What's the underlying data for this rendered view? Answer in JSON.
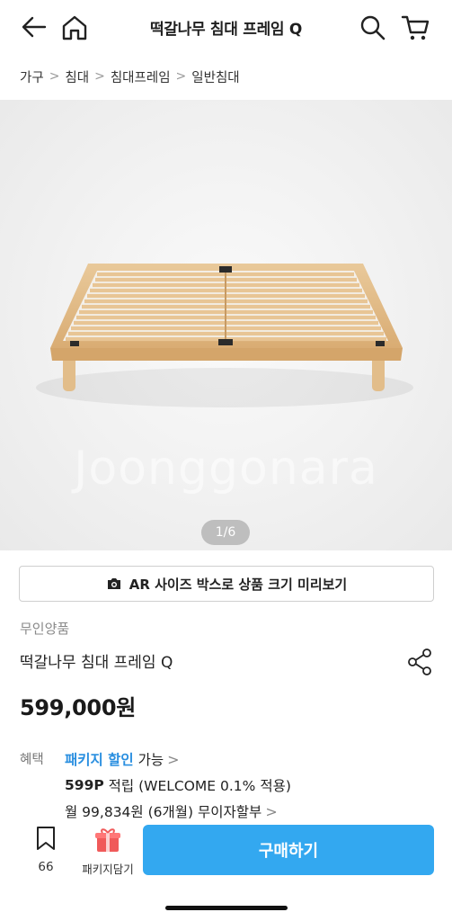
{
  "header": {
    "title": "떡갈나무 침대 프레임 Q",
    "back_icon": "back-arrow-icon",
    "home_icon": "home-icon",
    "search_icon": "search-icon",
    "cart_icon": "cart-icon"
  },
  "breadcrumb": [
    "가구",
    "침대",
    "침대프레임",
    "일반침대"
  ],
  "gallery": {
    "counter": "1/6",
    "watermark": "Joonggonara"
  },
  "ar_button": {
    "icon": "camera-icon",
    "label": "AR 사이즈 박스로 상품 크기 미리보기"
  },
  "product": {
    "brand": "무인양품",
    "name": "떡갈나무 침대 프레임 Q",
    "share_icon": "share-icon",
    "price": "599,000원"
  },
  "benefits": {
    "label": "혜택",
    "package_highlight": "패키지 할인",
    "package_suffix": "가능",
    "points_strong": "599P",
    "points_text": "적립 (WELCOME 0.1% 적용)",
    "installment": "월 99,834원 (6개월) 무이자할부"
  },
  "bottom_bar": {
    "bookmark_count": "66",
    "package_label": "패키지담기",
    "buy_label": "구매하기",
    "buy_color": "#33a8f0"
  }
}
